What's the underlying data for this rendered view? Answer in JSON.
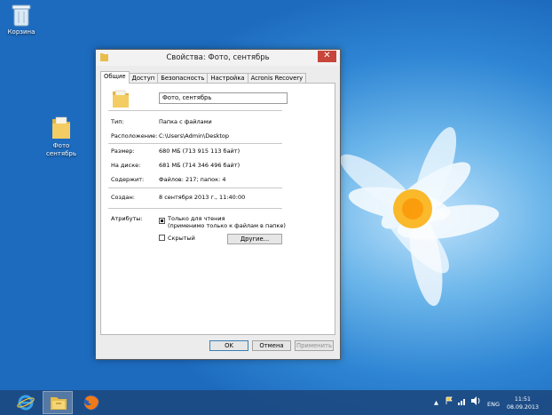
{
  "desktop": {
    "icons": [
      {
        "label": "Корзина"
      },
      {
        "label": "Фото\nсентябрь"
      }
    ]
  },
  "dialog": {
    "title": "Свойства: Фото, сентябрь",
    "close_glyph": "✕",
    "tabs": [
      "Общие",
      "Доступ",
      "Безопасность",
      "Настройка",
      "Acronis Recovery"
    ],
    "active_tab": "Общие",
    "name_value": "Фото, сентябрь",
    "rows": {
      "type_label": "Тип:",
      "type_value": "Папка с файлами",
      "location_label": "Расположение:",
      "location_value": "C:\\Users\\Admin\\Desktop",
      "size_label": "Размер:",
      "size_value": "680 МБ (713 915 113 байт)",
      "disk_label": "На диске:",
      "disk_value": "681 МБ (714 346 496 байт)",
      "contains_label": "Содержит:",
      "contains_value": "Файлов: 217; папок: 4",
      "created_label": "Создан:",
      "created_value": "8 сентября 2013 г., 11:40:00",
      "attributes_label": "Атрибуты:"
    },
    "attributes": {
      "readonly_label": "Только для чтения",
      "readonly_note": "(применимо только к файлам в папке)",
      "readonly_checked": true,
      "hidden_label": "Скрытый",
      "hidden_checked": false,
      "other_button": "Другие..."
    },
    "buttons": {
      "ok": "OK",
      "cancel": "Отмена",
      "apply": "Применить"
    }
  },
  "taskbar": {
    "apps": [
      "internet-explorer-icon",
      "file-explorer-icon",
      "firefox-icon"
    ],
    "language": "ENG",
    "time": "11:51",
    "date": "08.09.2013"
  },
  "colors": {
    "close_button": "#c7453a",
    "taskbar": "#1c487e",
    "desktop": "#2f86d4"
  }
}
